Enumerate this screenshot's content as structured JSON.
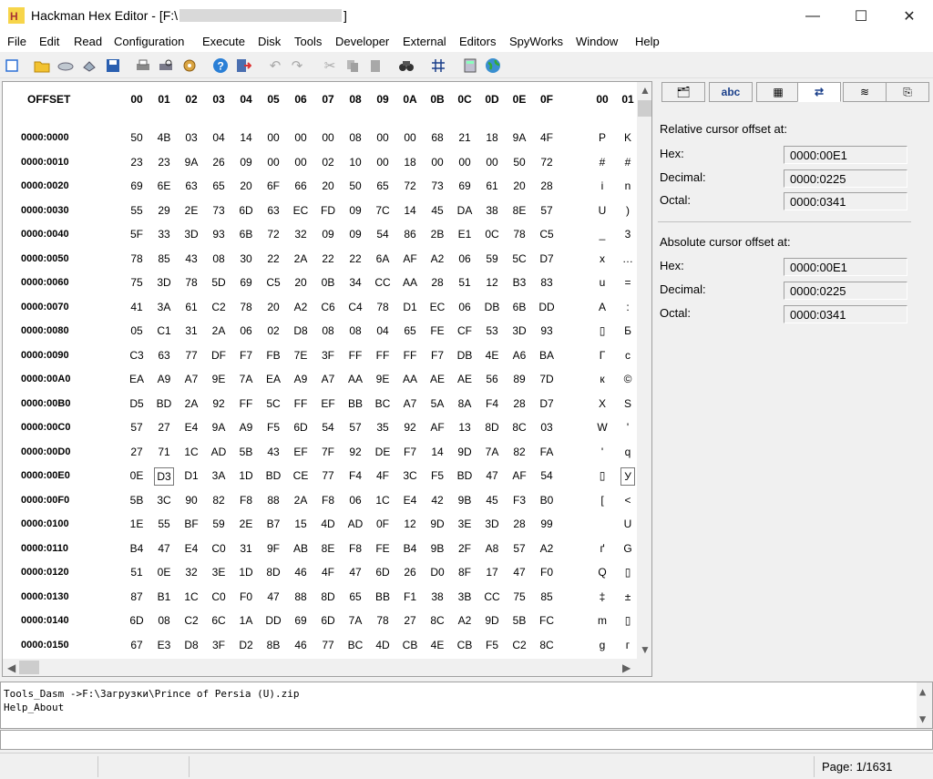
{
  "window": {
    "title_prefix": "Hackman Hex Editor - [F:\\",
    "title_suffix": "]",
    "controls": {
      "minimize": "—",
      "maximize": "☐",
      "close": "✕"
    }
  },
  "menu": [
    "File",
    "Edit",
    "Read",
    "Configuration",
    "Execute",
    "Disk",
    "Tools",
    "Developer",
    "External",
    "Editors",
    "SpyWorks",
    "Window",
    "Help"
  ],
  "toolbar_icons": [
    "new-icon",
    "open-icon",
    "disk-icon",
    "open-disk-icon",
    "save-icon",
    "print-icon",
    "print-preview-icon",
    "settings-icon",
    "help-icon",
    "exit-icon",
    "undo-icon",
    "redo-icon",
    "cut-icon",
    "copy-icon",
    "paste-icon",
    "find-icon",
    "grid-icon",
    "calculator-icon",
    "globe-icon"
  ],
  "hex": {
    "offset_header": "OFFSET",
    "columns": [
      "00",
      "01",
      "02",
      "03",
      "04",
      "05",
      "06",
      "07",
      "08",
      "09",
      "0A",
      "0B",
      "0C",
      "0D",
      "0E",
      "0F"
    ],
    "char_columns": [
      "00",
      "01"
    ],
    "rows": [
      {
        "offset": "0000:0000",
        "bytes": [
          "50",
          "4B",
          "03",
          "04",
          "14",
          "00",
          "00",
          "00",
          "08",
          "00",
          "00",
          "68",
          "21",
          "18",
          "9A",
          "4F"
        ],
        "chars": [
          "P",
          "K"
        ]
      },
      {
        "offset": "0000:0010",
        "bytes": [
          "23",
          "23",
          "9A",
          "26",
          "09",
          "00",
          "00",
          "02",
          "10",
          "00",
          "18",
          "00",
          "00",
          "00",
          "50",
          "72"
        ],
        "chars": [
          "#",
          "#"
        ]
      },
      {
        "offset": "0000:0020",
        "bytes": [
          "69",
          "6E",
          "63",
          "65",
          "20",
          "6F",
          "66",
          "20",
          "50",
          "65",
          "72",
          "73",
          "69",
          "61",
          "20",
          "28"
        ],
        "chars": [
          "i",
          "n"
        ]
      },
      {
        "offset": "0000:0030",
        "bytes": [
          "55",
          "29",
          "2E",
          "73",
          "6D",
          "63",
          "EC",
          "FD",
          "09",
          "7C",
          "14",
          "45",
          "DA",
          "38",
          "8E",
          "57"
        ],
        "chars": [
          "U",
          ")"
        ]
      },
      {
        "offset": "0000:0040",
        "bytes": [
          "5F",
          "33",
          "3D",
          "93",
          "6B",
          "72",
          "32",
          "09",
          "09",
          "54",
          "86",
          "2B",
          "E1",
          "0C",
          "78",
          "C5"
        ],
        "chars": [
          "_",
          "3"
        ]
      },
      {
        "offset": "0000:0050",
        "bytes": [
          "78",
          "85",
          "43",
          "08",
          "30",
          "22",
          "2A",
          "22",
          "22",
          "6A",
          "AF",
          "A2",
          "06",
          "59",
          "5C",
          "D7"
        ],
        "chars": [
          "x",
          "…"
        ]
      },
      {
        "offset": "0000:0060",
        "bytes": [
          "75",
          "3D",
          "78",
          "5D",
          "69",
          "C5",
          "20",
          "0B",
          "34",
          "CC",
          "AA",
          "28",
          "51",
          "12",
          "B3",
          "83"
        ],
        "chars": [
          "u",
          "="
        ]
      },
      {
        "offset": "0000:0070",
        "bytes": [
          "41",
          "3A",
          "61",
          "C2",
          "78",
          "20",
          "A2",
          "C6",
          "C4",
          "78",
          "D1",
          "EC",
          "06",
          "DB",
          "6B",
          "DD"
        ],
        "chars": [
          "A",
          ":"
        ]
      },
      {
        "offset": "0000:0080",
        "bytes": [
          "05",
          "C1",
          "31",
          "2A",
          "06",
          "02",
          "D8",
          "08",
          "08",
          "04",
          "65",
          "FE",
          "CF",
          "53",
          "3D",
          "93"
        ],
        "chars": [
          "▯",
          "Б"
        ]
      },
      {
        "offset": "0000:0090",
        "bytes": [
          "C3",
          "63",
          "77",
          "DF",
          "F7",
          "FB",
          "7E",
          "3F",
          "FF",
          "FF",
          "FF",
          "F7",
          "DB",
          "4E",
          "A6",
          "BA"
        ],
        "chars": [
          "Г",
          "c"
        ]
      },
      {
        "offset": "0000:00A0",
        "bytes": [
          "EA",
          "A9",
          "A7",
          "9E",
          "7A",
          "EA",
          "A9",
          "A7",
          "AA",
          "9E",
          "AA",
          "AE",
          "AE",
          "56",
          "89",
          "7D"
        ],
        "chars": [
          "к",
          "©"
        ]
      },
      {
        "offset": "0000:00B0",
        "bytes": [
          "D5",
          "BD",
          "2A",
          "92",
          "FF",
          "5C",
          "FF",
          "EF",
          "BB",
          "BC",
          "A7",
          "5A",
          "8A",
          "F4",
          "28",
          "D7"
        ],
        "chars": [
          "Х",
          "S"
        ]
      },
      {
        "offset": "0000:00C0",
        "bytes": [
          "57",
          "27",
          "E4",
          "9A",
          "A9",
          "F5",
          "6D",
          "54",
          "57",
          "35",
          "92",
          "AF",
          "13",
          "8D",
          "8C",
          "03"
        ],
        "chars": [
          "W",
          "'"
        ]
      },
      {
        "offset": "0000:00D0",
        "bytes": [
          "27",
          "71",
          "1C",
          "AD",
          "5B",
          "43",
          "EF",
          "7F",
          "92",
          "DE",
          "F7",
          "14",
          "9D",
          "7A",
          "82",
          "FA"
        ],
        "chars": [
          "'",
          "q"
        ]
      },
      {
        "offset": "0000:00E0",
        "bytes": [
          "0E",
          "D3",
          "D1",
          "3A",
          "1D",
          "BD",
          "CE",
          "77",
          "F4",
          "4F",
          "3C",
          "F5",
          "BD",
          "47",
          "AF",
          "54"
        ],
        "chars": [
          "▯",
          "У"
        ]
      },
      {
        "offset": "0000:00F0",
        "bytes": [
          "5B",
          "3C",
          "90",
          "82",
          "F8",
          "88",
          "2A",
          "F8",
          "06",
          "1C",
          "E4",
          "42",
          "9B",
          "45",
          "F3",
          "B0"
        ],
        "chars": [
          "[",
          "<"
        ]
      },
      {
        "offset": "0000:0100",
        "bytes": [
          "1E",
          "55",
          "BF",
          "59",
          "2E",
          "B7",
          "15",
          "4D",
          "AD",
          "0F",
          "12",
          "9D",
          "3E",
          "3D",
          "28",
          "99"
        ],
        "chars": [
          "",
          "U"
        ]
      },
      {
        "offset": "0000:0110",
        "bytes": [
          "B4",
          "47",
          "E4",
          "C0",
          "31",
          "9F",
          "AB",
          "8E",
          "F8",
          "FE",
          "B4",
          "9B",
          "2F",
          "A8",
          "57",
          "A2"
        ],
        "chars": [
          "ґ",
          "G"
        ]
      },
      {
        "offset": "0000:0120",
        "bytes": [
          "51",
          "0E",
          "32",
          "3E",
          "1D",
          "8D",
          "46",
          "4F",
          "47",
          "6D",
          "26",
          "D0",
          "8F",
          "17",
          "47",
          "F0"
        ],
        "chars": [
          "Q",
          "▯"
        ]
      },
      {
        "offset": "0000:0130",
        "bytes": [
          "87",
          "B1",
          "1C",
          "C0",
          "F0",
          "47",
          "88",
          "8D",
          "65",
          "BB",
          "F1",
          "38",
          "3B",
          "CC",
          "75",
          "85"
        ],
        "chars": [
          "‡",
          "±"
        ]
      },
      {
        "offset": "0000:0140",
        "bytes": [
          "6D",
          "08",
          "C2",
          "6C",
          "1A",
          "DD",
          "69",
          "6D",
          "7A",
          "78",
          "27",
          "8C",
          "A2",
          "9D",
          "5B",
          "FC"
        ],
        "chars": [
          "m",
          "▯"
        ]
      },
      {
        "offset": "0000:0150",
        "bytes": [
          "67",
          "E3",
          "D8",
          "3F",
          "D2",
          "8B",
          "46",
          "77",
          "BC",
          "4D",
          "CB",
          "4E",
          "CB",
          "F5",
          "C2",
          "8C"
        ],
        "chars": [
          "g",
          "г"
        ]
      }
    ]
  },
  "right_panel": {
    "tabs": [
      "folders-icon",
      "abc",
      "table-icon",
      "hex-convert-icon",
      "layers-icon",
      "export-icon"
    ],
    "tab_abc_label": "abc",
    "relative": {
      "heading": "Relative cursor offset at:",
      "hex_label": "Hex:",
      "hex": "0000:00E1",
      "dec_label": "Decimal:",
      "dec": "0000:0225",
      "oct_label": "Octal:",
      "oct": "0000:0341"
    },
    "absolute": {
      "heading": "Absolute cursor offset at:",
      "hex_label": "Hex:",
      "hex": "0000:00E1",
      "dec_label": "Decimal:",
      "dec": "0000:0225",
      "oct_label": "Octal:",
      "oct": "0000:0341"
    }
  },
  "log": {
    "line1": "Tools_Dasm ->F:\\Загрузки\\Prince of Persia (U).zip",
    "line2": "Help_About"
  },
  "status": {
    "page": "Page: 1/1631"
  }
}
